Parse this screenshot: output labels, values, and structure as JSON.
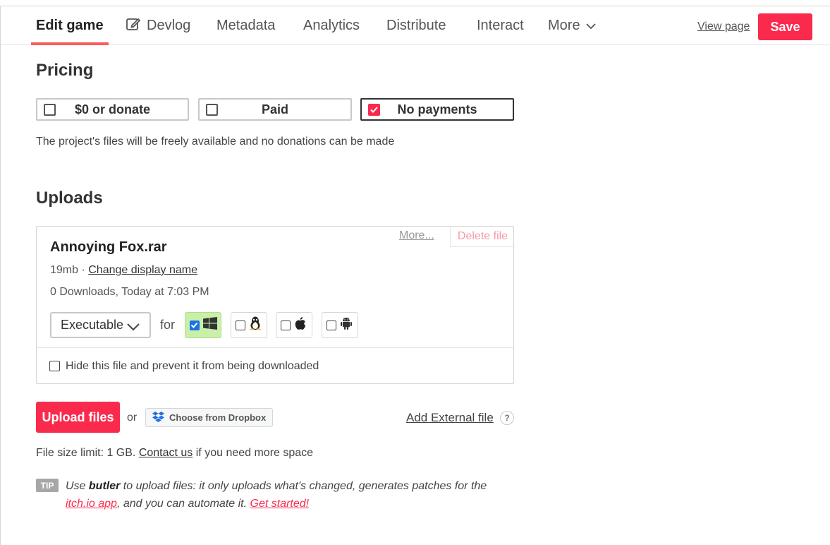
{
  "nav": {
    "tabs": [
      {
        "label": "Edit game"
      },
      {
        "label": "Devlog"
      },
      {
        "label": "Metadata"
      },
      {
        "label": "Analytics"
      },
      {
        "label": "Distribute"
      },
      {
        "label": "Interact"
      },
      {
        "label": "More"
      }
    ],
    "view_page": "View page",
    "save": "Save"
  },
  "pricing": {
    "title": "Pricing",
    "options": [
      {
        "label": "$0 or donate",
        "selected": false
      },
      {
        "label": "Paid",
        "selected": false
      },
      {
        "label": "No payments",
        "selected": true
      }
    ],
    "description": "The project's files will be freely available and no donations can be made"
  },
  "uploads": {
    "title": "Uploads",
    "file": {
      "more": "More...",
      "delete": "Delete file",
      "name": "Annoying Fox.rar",
      "size": "19mb",
      "separator": " · ",
      "change_name": "Change display name",
      "downloads": "0 Downloads, Today at 7:03 PM",
      "type": "Executable",
      "for_label": "for",
      "platforms": [
        {
          "name": "windows",
          "checked": true
        },
        {
          "name": "linux",
          "checked": false
        },
        {
          "name": "mac",
          "checked": false
        },
        {
          "name": "android",
          "checked": false
        }
      ],
      "hide_label": "Hide this file and prevent it from being downloaded"
    },
    "upload_button": "Upload files",
    "or": "or",
    "dropbox": "Choose from Dropbox",
    "external": "Add External file",
    "help": "?",
    "limit_prefix": "File size limit: 1 GB.",
    "limit_link": "Contact us",
    "limit_suffix": "if you need more space",
    "tip": {
      "badge": "TIP",
      "t1": "Use ",
      "butler": "butler",
      "t2": " to upload files: it only uploads what's changed, generates patches for the ",
      "itch_link": "itch.io app",
      "t3": ", and you can automate it. ",
      "get_started": "Get started!"
    }
  },
  "colors": {
    "accent": "#fa2a4d",
    "platform_on": "#c8f0a8"
  }
}
